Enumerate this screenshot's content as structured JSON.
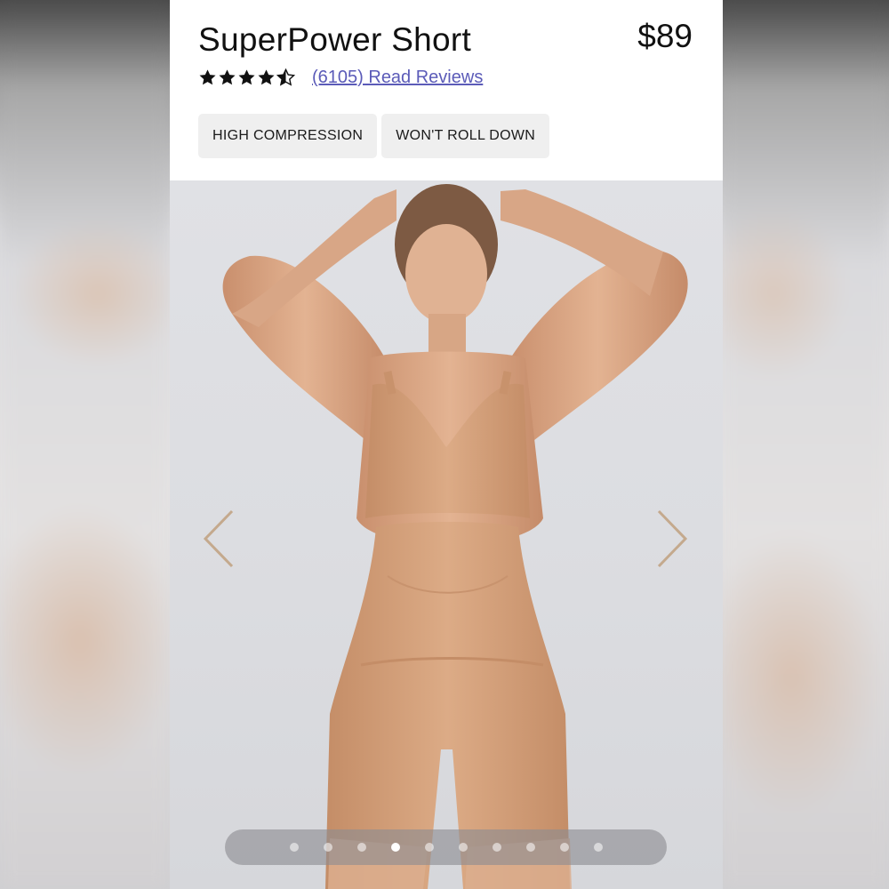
{
  "product": {
    "title": "SuperPower Short",
    "price": "$89",
    "rating": 4.5,
    "rating_max": 5,
    "review_link": "(6105) Read Reviews",
    "tags": [
      "HIGH COMPRESSION",
      "WON'T ROLL DOWN"
    ]
  },
  "gallery": {
    "image_description_icon": "model-photo",
    "prev_icon": "chevron-left-icon",
    "next_icon": "chevron-right-icon",
    "dot_count": 10,
    "active_dot": 4
  },
  "colors": {
    "star": "#111111",
    "link": "#5b5bb8",
    "tag_bg": "#efefef",
    "arrow": "#c4a98d",
    "skin": "#d9a987",
    "garment": "#d5a27a"
  }
}
